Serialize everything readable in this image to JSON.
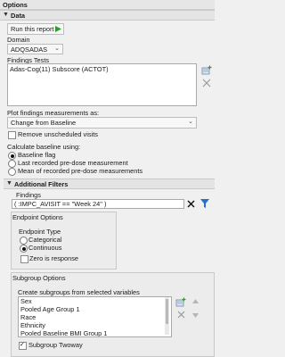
{
  "panel": {
    "title": "Options"
  },
  "data_section": {
    "title": "Data",
    "run_report_label": "Run this report",
    "domain_label": "Domain",
    "domain_value": "ADQSADAS",
    "findings_tests_label": "Findings Tests",
    "findings_tests_items": [
      "Adas-Cog(11) Subscore (ACTOT)"
    ],
    "plot_label": "Plot findings measurements as:",
    "plot_value": "Change from Baseline",
    "remove_unscheduled_label": "Remove unscheduled visits",
    "baseline_label": "Calculate baseline using:",
    "baseline_options": [
      "Baseline flag",
      "Last recorded pre-dose measurement",
      "Mean of recorded pre-dose measurements"
    ],
    "baseline_selected": 0
  },
  "filters_section": {
    "title": "Additional Filters",
    "findings_label": "Findings",
    "findings_value": "( :IMPC_AVISIT == \"Week 24\" )"
  },
  "endpoint_options": {
    "title": "Endpoint Options",
    "endpoint_type_label": "Endpoint Type",
    "types": [
      "Categorical",
      "Continuous"
    ],
    "selected": 1,
    "zero_is_response_label": "Zero is response"
  },
  "subgroup_options": {
    "title": "Subgroup Options",
    "create_label": "Create subgroups from selected variables",
    "variables": [
      "Sex",
      "Pooled Age Group 1",
      "Race",
      "Ethnicity",
      "Pooled Baseline BMI Group 1"
    ],
    "twoway_label": "Subgroup Twoway",
    "twoway_checked": true
  },
  "colors": {
    "play": "#2e9b2e",
    "filter": "#2a6fcf",
    "accent_blue": "#3a6fb0"
  }
}
